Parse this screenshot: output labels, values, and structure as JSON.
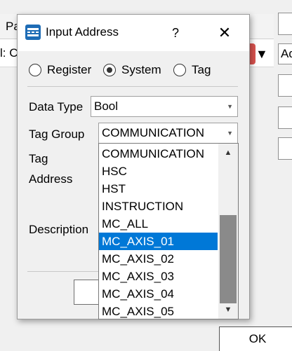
{
  "background": {
    "header_col1": "Pa",
    "row_text": "l: C",
    "right_text": "Ad",
    "ok_label": "OK"
  },
  "dialog": {
    "title": "Input Address",
    "help_symbol": "?",
    "close_symbol": "✕",
    "radio": [
      {
        "label": "Register",
        "checked": false
      },
      {
        "label": "System",
        "checked": true
      },
      {
        "label": "Tag",
        "checked": false
      }
    ],
    "data_type": {
      "label": "Data Type",
      "value": "Bool"
    },
    "tag_group": {
      "label": "Tag Group",
      "value": "COMMUNICATION"
    },
    "tag": {
      "label": "Tag"
    },
    "address": {
      "label": "Address"
    },
    "description": {
      "label": "Description"
    }
  },
  "dropdown": {
    "items": [
      "COMMUNICATION",
      "HSC",
      "HST",
      "INSTRUCTION",
      "MC_ALL",
      "MC_AXIS_01",
      "MC_AXIS_02",
      "MC_AXIS_03",
      "MC_AXIS_04",
      "MC_AXIS_05"
    ],
    "selected_index": 5,
    "up_arrow": "▲",
    "down_arrow": "▼"
  },
  "colors": {
    "selection": "#0078d7",
    "title_icon": "#1e6cb5",
    "accent_red": "#d9534f"
  }
}
